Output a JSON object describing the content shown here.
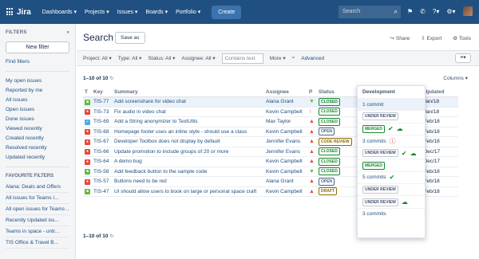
{
  "topbar": {
    "logo": "Jira",
    "nav": [
      "Dashboards ▾",
      "Projects ▾",
      "Issues ▾",
      "Boards ▾",
      "Portfolio ▾"
    ],
    "create_label": "Create",
    "search_placeholder": "Search",
    "icons": [
      "grid-icon",
      "search-icon",
      "notification-icon",
      "help-icon",
      "settings-icon",
      "avatar"
    ]
  },
  "sidebar": {
    "heading": "FILTERS",
    "new_filter": "New filter",
    "find_filters": "Find filters",
    "items": [
      "My open issues",
      "Reported by me",
      "All issues",
      "Open issues",
      "Done issues",
      "Viewed recently",
      "Created recently",
      "Resolved recently",
      "Updated recently"
    ],
    "favourites_heading": "FAVOURITE FILTERS",
    "favourites": [
      "Alana: Deals and Offers",
      "All issues for Teams i...",
      "All open issues for Teams ...",
      "Recently Updated iss...",
      "Teams in space - untr...",
      "TIS Office & Travel B..."
    ]
  },
  "header": {
    "title": "Search",
    "save_as": "Save as",
    "share": "Share",
    "export": "Export",
    "tools": "Tools"
  },
  "filters": {
    "project": "Project: All ▾",
    "type": "Type: All ▾",
    "status": "Status: All ▾",
    "assignee": "Assignee: All ▾",
    "contains_placeholder": "Contains text",
    "more": "More ▾",
    "advanced": "Advanced"
  },
  "results": {
    "count": "1–10 of 10",
    "count_bottom": "1–10 of 10",
    "columns": "Columns ▾",
    "headers": [
      "T",
      "Key",
      "Summary",
      "Assignee",
      "P",
      "Status",
      "Updated"
    ],
    "rows": [
      {
        "type": "story",
        "key": "TIS-77",
        "summary": "Add screenshare for video chat",
        "assignee": "Alana Grant",
        "priority": "low",
        "status": "CLOSED",
        "updated": "Jan/18"
      },
      {
        "type": "bug",
        "key": "TIS-73",
        "summary": "Fix audio in video chat",
        "assignee": "Kevin Campbell",
        "priority": "highest",
        "status": "CLOSED",
        "updated": "Jan/18"
      },
      {
        "type": "task",
        "key": "TIS-69",
        "summary": "Add a String anonymizer to TextUtils",
        "assignee": "Max Taylor",
        "priority": "high",
        "status": "CLOSED",
        "updated": "Feb/18"
      },
      {
        "type": "bug",
        "key": "TIS-68",
        "summary": "Homepage footer uses an inline style - should use a class",
        "assignee": "Kevin Campbell",
        "priority": "high",
        "status": "OPEN",
        "updated": "Feb/18"
      },
      {
        "type": "bug",
        "key": "TIS-67",
        "summary": "Developer Toolbox does not display by default",
        "assignee": "Jennifer Evans",
        "priority": "high",
        "status": "CODE REVIEW",
        "updated": "Feb/18"
      },
      {
        "type": "bug",
        "key": "TIS-66",
        "summary": "Update promotion to include groups of 20 or more",
        "assignee": "Jennifer Evans",
        "priority": "high",
        "status": "CLOSED",
        "updated": "Dec/17"
      },
      {
        "type": "bug",
        "key": "TIS-64",
        "summary": "A demo bug",
        "assignee": "Kevin Campbell",
        "priority": "high",
        "status": "CLOSED",
        "updated": "Dec/17"
      },
      {
        "type": "story",
        "key": "TIS-58",
        "summary": "Add feedback button to the sample code",
        "assignee": "Kevin Campbell",
        "priority": "low",
        "status": "CLOSED",
        "updated": "Feb/18"
      },
      {
        "type": "bug",
        "key": "TIS-57",
        "summary": "Buttons need to be red",
        "assignee": "Alana Grant",
        "priority": "high",
        "status": "OPEN",
        "updated": "Feb/18"
      },
      {
        "type": "story",
        "key": "TIS-47",
        "summary": "UI should allow users to book on large or personal space craft",
        "assignee": "Kevin Campbell",
        "priority": "high",
        "status": "DRAFT",
        "updated": "Feb/18"
      }
    ]
  },
  "development": {
    "heading": "Development",
    "rows": [
      {
        "text": "1 commit",
        "kind": "link",
        "icons": []
      },
      {
        "text": "UNDER REVIEW",
        "kind": "lozenge",
        "icons": []
      },
      {
        "text": "MERGED",
        "kind": "lozenge-green",
        "icons": [
          "check",
          "build"
        ]
      },
      {
        "text": "3 commits",
        "kind": "link",
        "icons": [
          "error"
        ]
      },
      {
        "text": "UNDER REVIEW",
        "kind": "lozenge",
        "icons": [
          "check",
          "build"
        ]
      },
      {
        "text": "MERGED",
        "kind": "lozenge-green",
        "icons": []
      },
      {
        "text": "5 commits",
        "kind": "link",
        "icons": [
          "check"
        ]
      },
      {
        "text": "UNDER REVIEW",
        "kind": "lozenge",
        "icons": []
      },
      {
        "text": "UNDER REVIEW",
        "kind": "lozenge",
        "icons": [
          "build"
        ]
      },
      {
        "text": "3 commits",
        "kind": "link",
        "icons": []
      }
    ]
  },
  "colors": {
    "header_bg": "#205081",
    "link": "#205081",
    "story": "#63ba3c",
    "bug": "#e5493a",
    "task": "#4bade8",
    "closed": "#14892c",
    "open": "#4a6785",
    "review": "#f6c342"
  }
}
